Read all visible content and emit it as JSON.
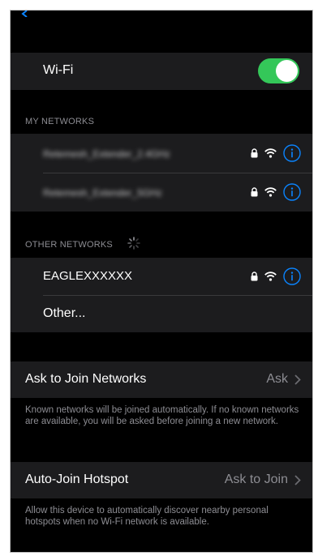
{
  "wifi": {
    "label": "Wi-Fi",
    "enabled": true
  },
  "my_networks": {
    "header": "MY NETWORKS",
    "items": [
      {
        "name": "Retemesh_Extender_2.4GHz",
        "locked": true
      },
      {
        "name": "Retemesh_Extender_5GHz",
        "locked": true
      }
    ]
  },
  "other_networks": {
    "header": "OTHER NETWORKS",
    "items": [
      {
        "name": "EAGLEXXXXXX",
        "locked": true
      }
    ],
    "other_label": "Other..."
  },
  "ask_to_join": {
    "label": "Ask to Join Networks",
    "value": "Ask",
    "footnote": "Known networks will be joined automatically. If no known networks are available, you will be asked before joining a new network."
  },
  "auto_join_hotspot": {
    "label": "Auto-Join Hotspot",
    "value": "Ask to Join",
    "footnote": "Allow this device to automatically discover nearby personal hotspots when no Wi-Fi network is available."
  },
  "colors": {
    "accent": "#0a84ff",
    "toggle_on": "#34c759",
    "cell": "#1c1c1e",
    "secondary_text": "#8d8d93"
  }
}
